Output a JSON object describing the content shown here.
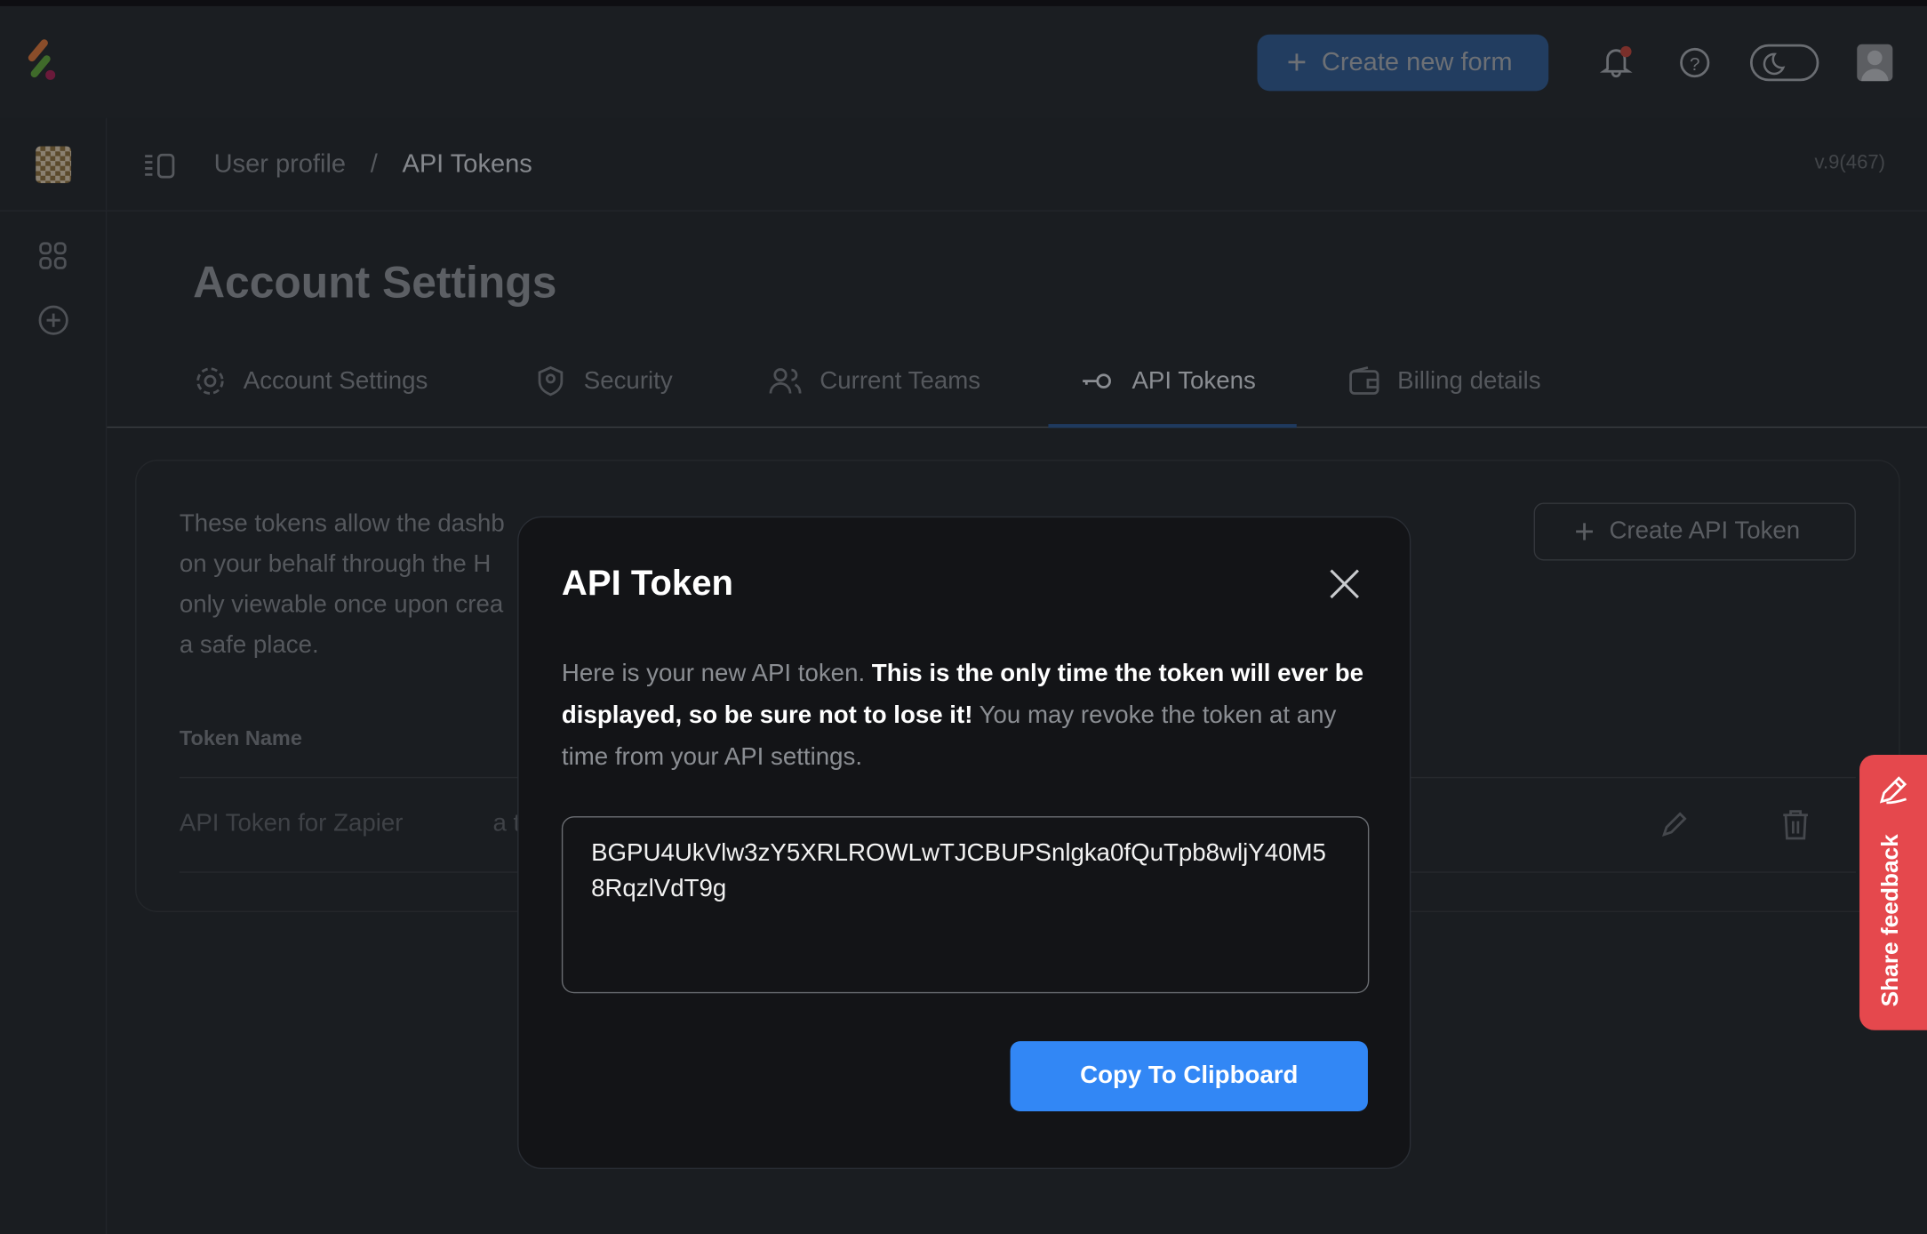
{
  "header": {
    "create_label": "Create new form",
    "logo_colors": [
      "#8a4d2a",
      "#3f6a2a",
      "#6a1a3a"
    ],
    "icons": [
      "bell-icon",
      "help-icon",
      "theme-toggle-moon-icon",
      "avatar-icon"
    ]
  },
  "breadcrumb": {
    "parent": "User profile",
    "separator": "/",
    "current": "API Tokens",
    "version": "v.9(467)"
  },
  "page": {
    "title": "Account Settings"
  },
  "tabs": [
    {
      "label": "Account Settings",
      "icon": "gear-icon"
    },
    {
      "label": "Security",
      "icon": "shield-user-icon"
    },
    {
      "label": "Current Teams",
      "icon": "users-icon"
    },
    {
      "label": "API Tokens",
      "icon": "key-icon",
      "active": true
    },
    {
      "label": "Billing details",
      "icon": "wallet-icon"
    }
  ],
  "card": {
    "description_lines": [
      "These tokens allow the dashb",
      "on your behalf through the H",
      "only viewable once upon crea",
      "a safe place."
    ],
    "create_label": "Create API Token",
    "column_token_name": "Token Name",
    "rows": [
      {
        "name": "API Token for Zapier",
        "partial": "a t"
      }
    ]
  },
  "modal": {
    "title": "API Token",
    "intro": "Here is your new API token. ",
    "warning": "This is the only time the token will ever be displayed, so be sure not to lose it!",
    "outro": " You may revoke the token at any time from your API settings.",
    "token": "BGPU4UkVlw3zY5XRLROWLwTJCBUPSnlgka0fQuTpb8wljY40M58RqzlVdT9g",
    "copy_label": "Copy To Clipboard"
  },
  "feedback": {
    "label": "Share feedback",
    "color": "#e5484d"
  },
  "colors": {
    "accent": "#3287f5"
  }
}
